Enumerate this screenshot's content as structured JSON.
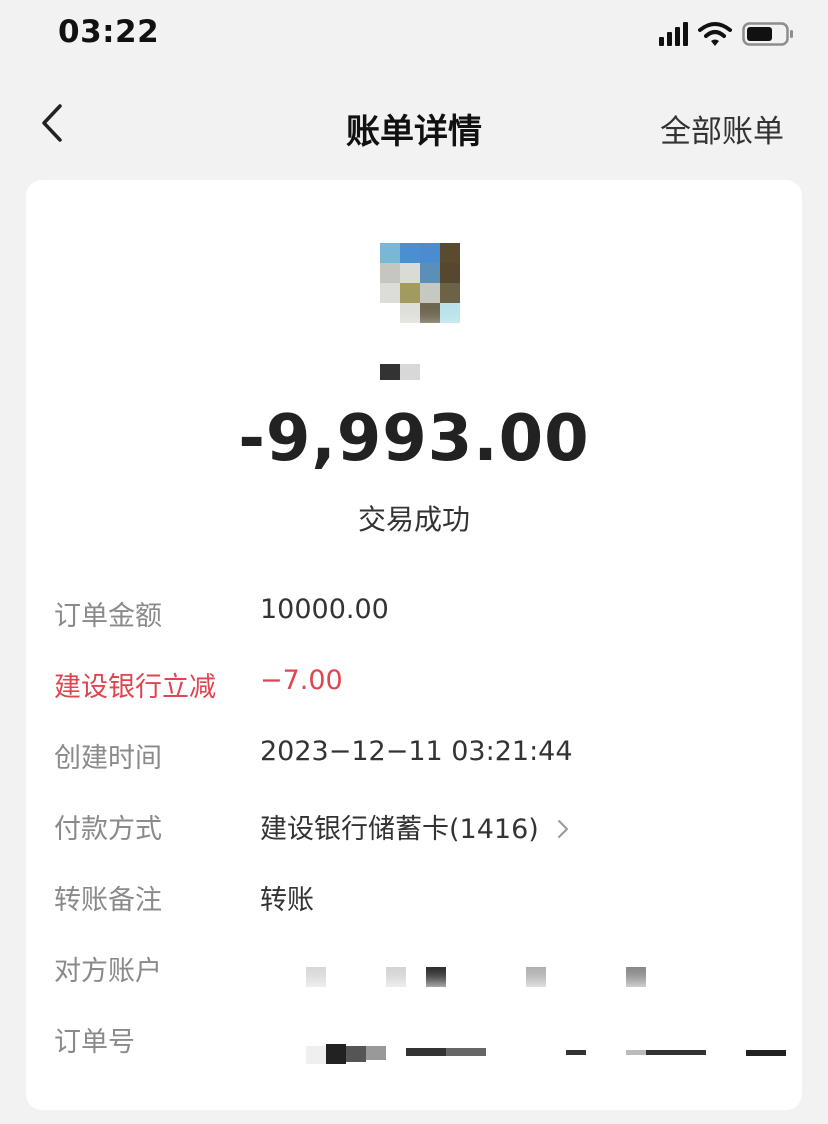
{
  "status_bar": {
    "time": "03:22"
  },
  "nav": {
    "title": "账单详情",
    "right_link": "全部账单"
  },
  "transaction": {
    "amount": "-9,993.00",
    "status": "交易成功"
  },
  "details": [
    {
      "label": "订单金额",
      "value": "10000.00"
    },
    {
      "label": "建设银行立减",
      "value": "−7.00"
    },
    {
      "label": "创建时间",
      "value": "2023−12−11 03:21:44"
    },
    {
      "label": "付款方式",
      "value": "建设银行储蓄卡(1416)"
    },
    {
      "label": "转账备注",
      "value": "转账"
    },
    {
      "label": "对方账户",
      "value": ""
    },
    {
      "label": "订单号",
      "value": ""
    }
  ],
  "colors": {
    "background": "#f2f2f2",
    "card": "#ffffff",
    "discount_red": "#e0454f",
    "label_gray": "#8a8a8a"
  },
  "icons": {
    "back": "chevron-left-icon",
    "payment_more": "chevron-right-icon",
    "signal": "signal-icon",
    "wifi": "wifi-icon",
    "battery": "battery-icon"
  }
}
